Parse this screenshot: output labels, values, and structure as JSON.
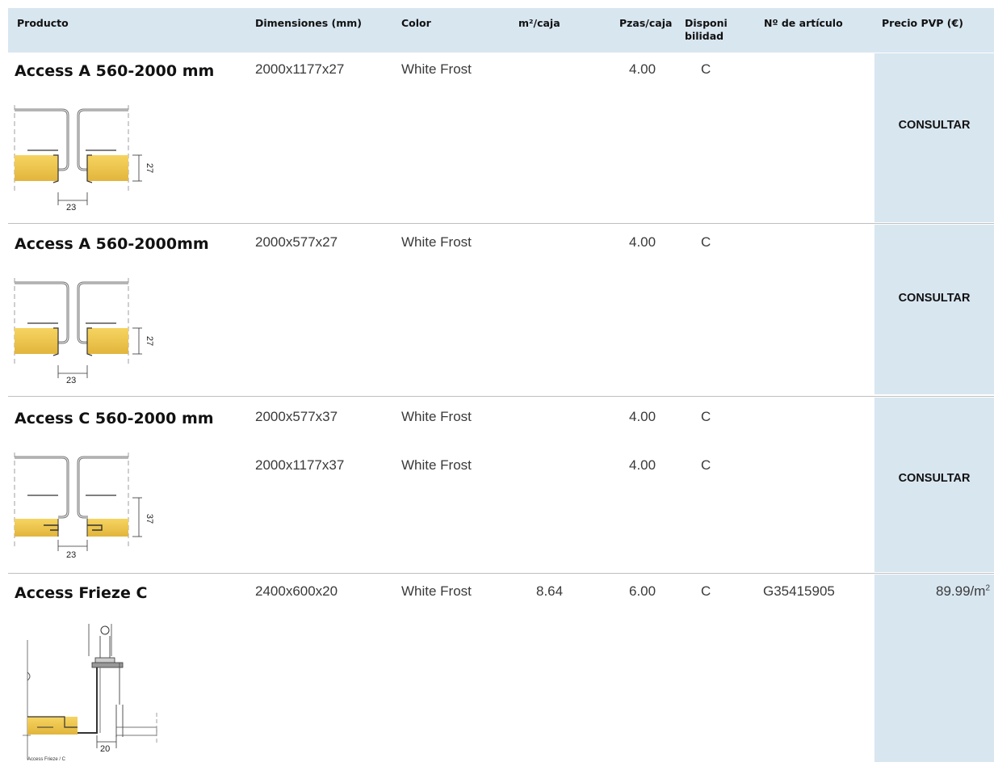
{
  "headers": {
    "producto": "Producto",
    "dimensiones": "Dimensiones (mm)",
    "color": "Color",
    "m2_caja": "m²/caja",
    "pzas_caja": "Pzas/caja",
    "disponibilidad_1": "Disponi",
    "disponibilidad_2": "bilidad",
    "articulo": "Nº de artículo",
    "precio": "Precio PVP (€)"
  },
  "rows": [
    {
      "name": "Access A 560-2000 mm",
      "lines": [
        {
          "dimensiones": "2000x1177x27",
          "color": "White Frost",
          "pzas": "4.00",
          "disp": "C"
        }
      ],
      "precio": "CONSULTAR",
      "drawing": {
        "height_label": "27",
        "width_label": "23",
        "icon": "access-a-profile-drawing"
      }
    },
    {
      "name": "Access A 560-2000mm",
      "lines": [
        {
          "dimensiones": "2000x577x27",
          "color": "White Frost",
          "pzas": "4.00",
          "disp": "C"
        }
      ],
      "precio": "CONSULTAR",
      "drawing": {
        "height_label": "27",
        "width_label": "23",
        "icon": "access-a-profile-drawing"
      }
    },
    {
      "name": "Access C 560-2000 mm",
      "lines": [
        {
          "dimensiones": "2000x577x37",
          "color": "White Frost",
          "pzas": "4.00",
          "disp": "C"
        },
        {
          "dimensiones": "2000x1177x37",
          "color": "White Frost",
          "pzas": "4.00",
          "disp": "C"
        }
      ],
      "precio": "CONSULTAR",
      "drawing": {
        "height_label": "37",
        "width_label": "23",
        "icon": "access-c-profile-drawing"
      }
    },
    {
      "name": "Access Frieze C",
      "lines": [
        {
          "dimensiones": "2400x600x20",
          "color": "White Frost",
          "m2": "8.64",
          "pzas": "6.00",
          "disp": "C",
          "articulo": "G35415905"
        }
      ],
      "precio_value": "89.99/m",
      "precio_unit_sup": "2",
      "drawing": {
        "width_label": "20",
        "caption": "Access Frieze / C",
        "icon": "access-frieze-c-drawing"
      }
    }
  ],
  "colors": {
    "header_bg": "#d8e6f0",
    "tile_yellow": "#f0c94a",
    "line": "#bfbfbf"
  }
}
